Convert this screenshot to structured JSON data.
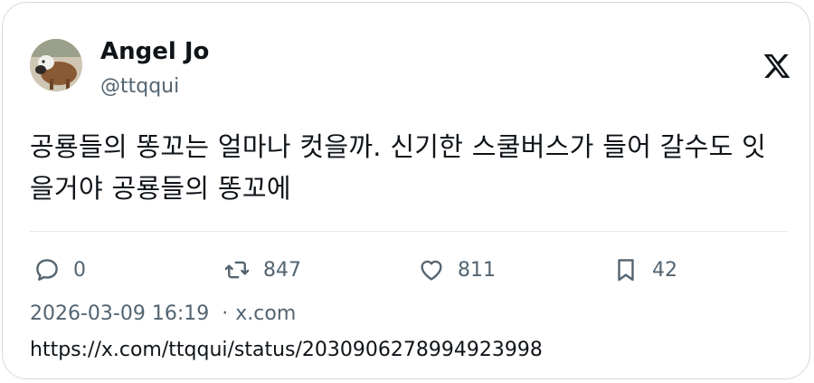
{
  "author": {
    "display_name": "Angel Jo",
    "handle": "@ttqqui"
  },
  "tweet": {
    "text": "공룡들의 똥꼬는 얼마나 컷을까. 신기한 스쿨버스가 들어 갈수도 잇을거야 공룡들의 똥꼬에"
  },
  "actions": {
    "reply_count": "0",
    "retweet_count": "847",
    "like_count": "811",
    "bookmark_count": "42"
  },
  "meta": {
    "timestamp": "2026-03-09 16:19",
    "separator": "·",
    "source": "x.com"
  },
  "url": "https://x.com/ttqqui/status/2030906278994923998",
  "icons": {
    "brand": "x-logo-icon",
    "reply": "speech-bubble-icon",
    "retweet": "retweet-arrows-icon",
    "like": "heart-icon",
    "bookmark": "bookmark-icon"
  },
  "colors": {
    "text_primary": "#0f1419",
    "text_secondary": "#536471",
    "border": "#d6d9dc"
  }
}
